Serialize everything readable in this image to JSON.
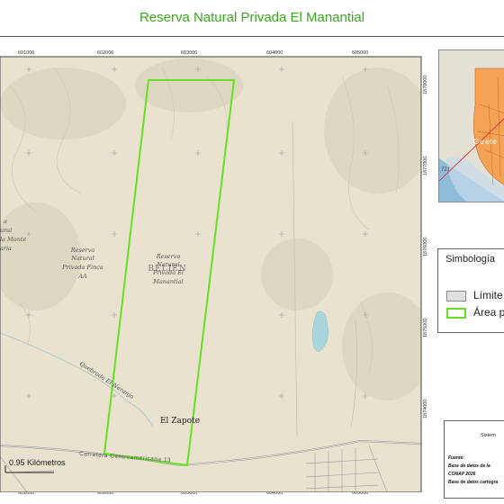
{
  "title": "Reserva Natural Privada El Manantial",
  "map": {
    "coord_labels_top": [
      "601000",
      "602000",
      "603000",
      "604000",
      "605000"
    ],
    "coord_labels_bottom": [
      "601000",
      "602000",
      "603000",
      "604000",
      "605000"
    ],
    "coord_labels_right": [
      "1878000",
      "1877000",
      "1876000",
      "1875000",
      "1874000"
    ],
    "places": {
      "reserve_aa": [
        "Reserva",
        "Natural",
        "Privada Finca",
        "AA"
      ],
      "reserve_manantial": [
        "Reserva",
        "Natural",
        "Privada El",
        "Manantial"
      ],
      "reserve_left": [
        "a",
        "ural",
        "la Monte",
        "aria"
      ],
      "region": "BELIEN",
      "town": "El Zapote",
      "river": "Quebrada El Naranjo",
      "road": "Carretera Centroamericana 13"
    },
    "scale_label": "0.95 Kilómetros",
    "colors": {
      "boundary": "#66e024",
      "base": "#e8e2cf",
      "water": "#a9d6dd"
    }
  },
  "inset": {
    "label": "Guate",
    "number": "721",
    "colors": {
      "country": "#f4a256",
      "sea": "#8fbcd8",
      "pointer": "#dd2222"
    }
  },
  "legend": {
    "title": "Simbología",
    "items": [
      {
        "label": "Límite",
        "fill": "#e0e0e0",
        "stroke": "#8a8a8a"
      },
      {
        "label": "Área pr",
        "fill": "#ffffff",
        "stroke": "#66e024"
      }
    ]
  },
  "info": {
    "header": "Sistem",
    "lines": [
      "Fuente:",
      "Base de datos de la",
      "CONAP 2026",
      "Base de datos cartogra"
    ]
  }
}
